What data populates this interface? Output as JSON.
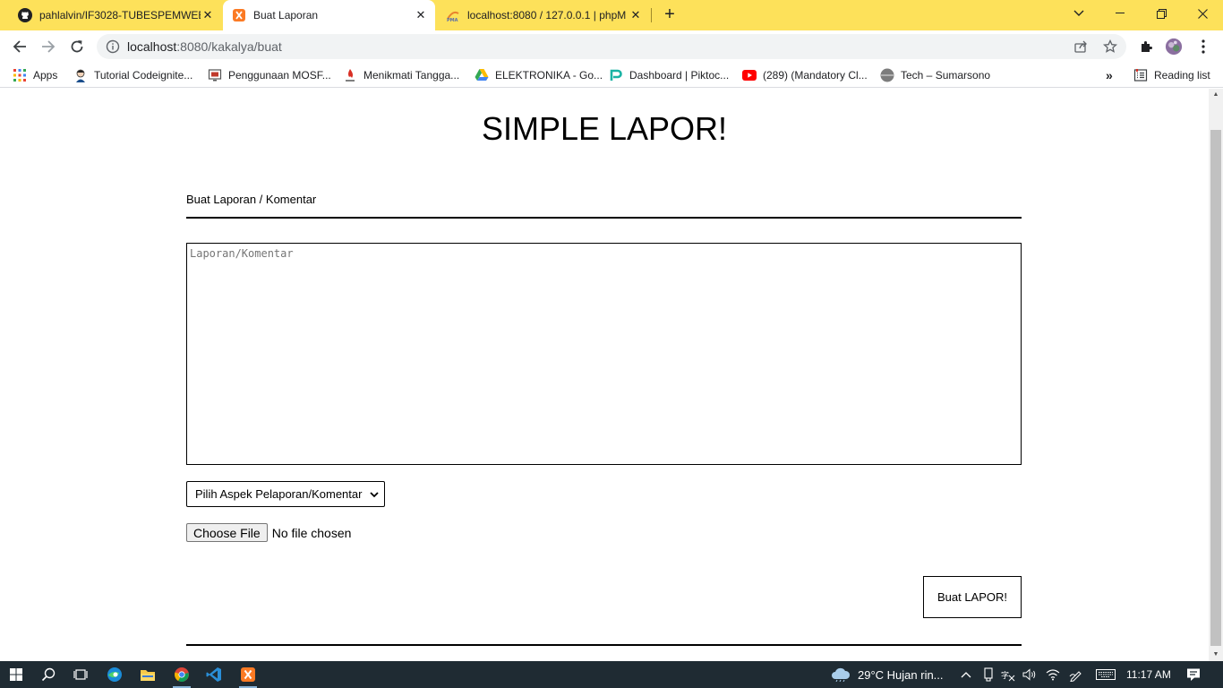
{
  "browser": {
    "tabs": [
      {
        "title": "pahlalvin/IF3028-TUBESPEMWEB",
        "active": false
      },
      {
        "title": "Buat Laporan",
        "active": true
      },
      {
        "title": "localhost:8080 / 127.0.0.1 | phpM",
        "active": false
      }
    ],
    "url_host": "localhost",
    "url_rest": ":8080/kakalya/buat",
    "bookmarks": [
      "Apps",
      "Tutorial Codeignite...",
      "Penggunaan MOSF...",
      "Menikmati Tangga...",
      "ELEKTRONIKA - Go...",
      "Dashboard | Piktoc...",
      "(289) (Mandatory Cl...",
      "Tech – Sumarsono"
    ],
    "reading_list": "Reading list",
    "overflow": "»"
  },
  "page": {
    "title": "SIMPLE LAPOR!",
    "section_label": "Buat Laporan / Komentar",
    "textarea_placeholder": "Laporan/Komentar",
    "aspect_select": "Pilih Aspek Pelaporan/Komentar",
    "choose_file": "Choose File",
    "no_file": "No file chosen",
    "submit": "Buat LAPOR!"
  },
  "taskbar": {
    "weather": "29°C  Hujan rin...",
    "time": "11:17 AM"
  },
  "colors": {
    "tab_strip": "#fde15a",
    "taskbar": "#1f2b33"
  }
}
